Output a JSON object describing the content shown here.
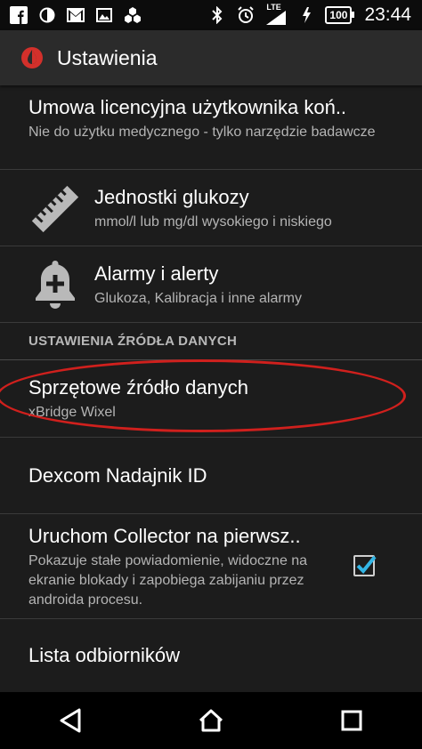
{
  "status_bar": {
    "time": "23:44",
    "battery": "100",
    "network": "LTE",
    "left_icons": [
      "facebook-icon",
      "contrast-icon",
      "gmail-icon",
      "image-icon",
      "hexagons-icon"
    ],
    "right_icons": [
      "bluetooth-icon",
      "alarm-icon",
      "signal-icon",
      "no-sim-icon",
      "battery-icon"
    ]
  },
  "app_bar": {
    "title": "Ustawienia",
    "logo": "blood-drop-icon"
  },
  "settings": {
    "license": {
      "title": "Umowa licencyjna użytkownika koń..",
      "summary": "Nie do użytku medycznego - tylko narzędzie badawcze"
    },
    "glucose_units": {
      "title": "Jednostki glukozy",
      "summary": "mmol/l lub mg/dl wysokiego i niskiego",
      "icon": "ruler-icon"
    },
    "alarms": {
      "title": "Alarmy i alerty",
      "summary": "Glukoza, Kalibracja i inne alarmy",
      "icon": "bell-plus-icon"
    },
    "data_source_header": "USTAWIENIA ŹRÓDŁA DANYCH",
    "hardware_source": {
      "title": "Sprzętowe źródło danych",
      "summary": "xBridge Wixel"
    },
    "dexcom_id": {
      "title": "Dexcom Nadajnik ID"
    },
    "collector": {
      "title": "Uruchom Collector na pierwsz..",
      "summary": "Pokazuje stałe powiadomienie, widoczne na ekranie blokady i zapobiega zabijaniu przez androida procesu.",
      "checked": true
    },
    "receivers": {
      "title": "Lista odbiorników"
    }
  },
  "nav_bar": {
    "buttons": [
      "back-icon",
      "home-icon",
      "recents-icon"
    ]
  },
  "colors": {
    "accent": "#33b5e5",
    "annotation": "#d0201d",
    "logo": "#d3302b",
    "background": "#1c1c1c"
  }
}
